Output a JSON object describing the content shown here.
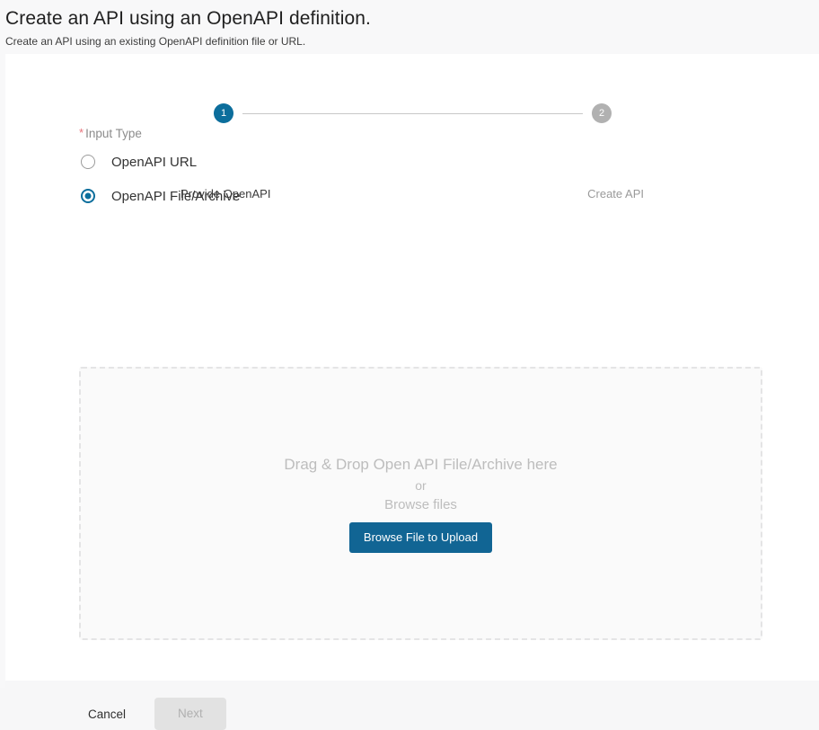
{
  "header": {
    "title": "Create an API using an OpenAPI definition.",
    "subtitle": "Create an API using an existing OpenAPI definition file or URL."
  },
  "stepper": {
    "steps": [
      {
        "number": "1",
        "label": "Provide OpenAPI",
        "state": "active"
      },
      {
        "number": "2",
        "label": "Create API",
        "state": "inactive"
      }
    ],
    "active_color": "#0c6e9c",
    "inactive_color": "#b1b1b1",
    "line_color": "#c8c8c8"
  },
  "form": {
    "input_type": {
      "label": "Input Type",
      "required_marker": "*",
      "required_color": "#e8727a",
      "options": [
        {
          "label": "OpenAPI URL",
          "selected": false
        },
        {
          "label": "OpenAPI File/Archive",
          "selected": true
        }
      ]
    }
  },
  "dropzone": {
    "primary_text": "Drag & Drop Open API File/Archive here",
    "or_text": "or",
    "browse_text": "Browse files",
    "button_label": "Browse File to Upload",
    "button_color": "#116594",
    "border_color": "#e4e4e5",
    "fill_color": "#fafafa"
  },
  "footer": {
    "cancel_label": "Cancel",
    "next_label": "Next",
    "next_disabled": true
  }
}
